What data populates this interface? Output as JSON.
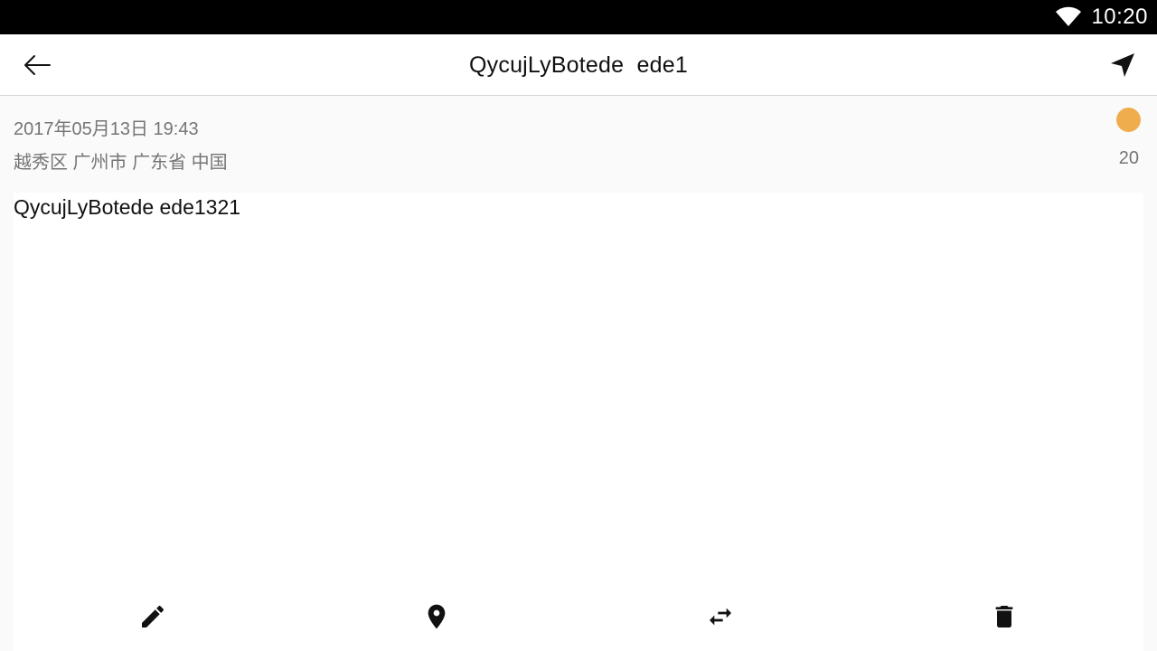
{
  "status_bar": {
    "time": "10:20",
    "wifi_icon": "wifi-icon"
  },
  "app_bar": {
    "title": "QycujLyBotede  ede1",
    "back_icon": "arrow-back-icon",
    "navigate_icon": "navigation-arrow-icon"
  },
  "note": {
    "date": "2017年05月13日 19:43",
    "location": "越秀区 广州市 广东省 中国",
    "count": "20",
    "status_color": "#f0ad4e",
    "body": "QycujLyBotede ede1321"
  },
  "toolbar": {
    "edit_icon": "edit-pencil-icon",
    "location_icon": "location-pin-icon",
    "swap_icon": "swap-arrows-icon",
    "delete_icon": "delete-trash-icon"
  }
}
